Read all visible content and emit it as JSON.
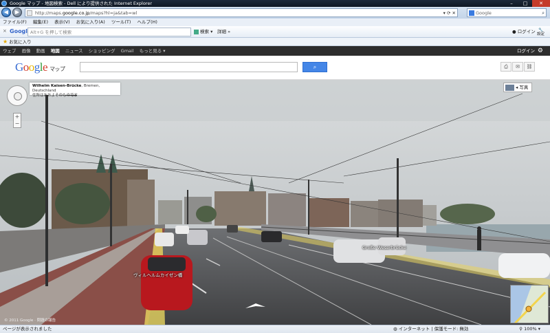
{
  "window": {
    "title": "Google マップ - 地図検索 - Dell により提供された Internet Explorer",
    "controls": [
      "–",
      "□",
      "✕"
    ]
  },
  "addressbar": {
    "url_prefix": "http://maps.",
    "url_domain": "google.co.jp",
    "url_suffix": "/maps?hl=ja&tab=wl",
    "search_placeholder": "Google"
  },
  "menubar": {
    "items": [
      "ファイル(F)",
      "編集(E)",
      "表示(V)",
      "お気に入り(A)",
      "ツール(T)",
      "ヘルプ(H)"
    ]
  },
  "google_toolbar": {
    "logo": "Google",
    "search_placeholder": "Alt+G を押して検索",
    "search_button": "検索",
    "more_button": "詳細 »",
    "login": "ログイン",
    "settings": "設定"
  },
  "favorites": {
    "label": "お気に入り"
  },
  "gbar": {
    "items": [
      "ウェブ",
      "画像",
      "動画",
      "地図",
      "ニュース",
      "ショッピング",
      "Gmail",
      "もっと見る ▾"
    ],
    "active_index": 3,
    "login": "ログイン"
  },
  "maps_header": {
    "logo_sub": "マップ",
    "search_value": ""
  },
  "streetview": {
    "place_name": "Wilhelm Kaisen-Brücke",
    "place_address": ", Bremen, Deutschland",
    "place_note": "住所はおおよそのものです",
    "photo_button": "写真",
    "road_label_1": "Große Weserbrücke",
    "road_label_2": "ヴィルヘルムカイゼン橋",
    "copyright": "© 2011 Google · 問題の報告"
  },
  "statusbar": {
    "left": "ページが表示されました",
    "zone": "インターネット | 保護モード: 無効",
    "zoom": "100%"
  }
}
